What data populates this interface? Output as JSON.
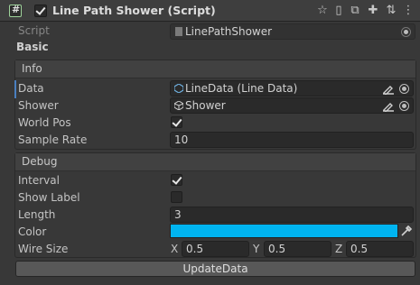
{
  "header": {
    "title": "Line Path Shower (Script)",
    "enabled": true,
    "icons": [
      "question-icon",
      "preset-icon",
      "layout-icon",
      "move-icon",
      "settings-slider-icon",
      "more-icon"
    ]
  },
  "script_row": {
    "label": "Script",
    "value": "LinePathShower"
  },
  "basic_label": "Basic",
  "info": {
    "title": "Info",
    "data": {
      "label": "Data",
      "value": "LineData (Line Data)"
    },
    "shower": {
      "label": "Shower",
      "value": "Shower"
    },
    "world_pos": {
      "label": "World Pos",
      "checked": true
    },
    "sample_rate": {
      "label": "Sample Rate",
      "value": "10"
    }
  },
  "debug": {
    "title": "Debug",
    "interval": {
      "label": "Interval",
      "checked": true
    },
    "show_label": {
      "label": "Show Label",
      "checked": false
    },
    "length": {
      "label": "Length",
      "value": "3"
    },
    "color": {
      "label": "Color",
      "value": "#00b4f0"
    },
    "wire_size": {
      "label": "Wire Size",
      "x_label": "X",
      "x": "0.5",
      "y_label": "Y",
      "y": "0.5",
      "z_label": "Z",
      "z": "0.5"
    }
  },
  "update_button": "UpdateData",
  "colors": {
    "background": "#383838",
    "field": "#2a2a2a",
    "accent": "#00b4f0"
  }
}
